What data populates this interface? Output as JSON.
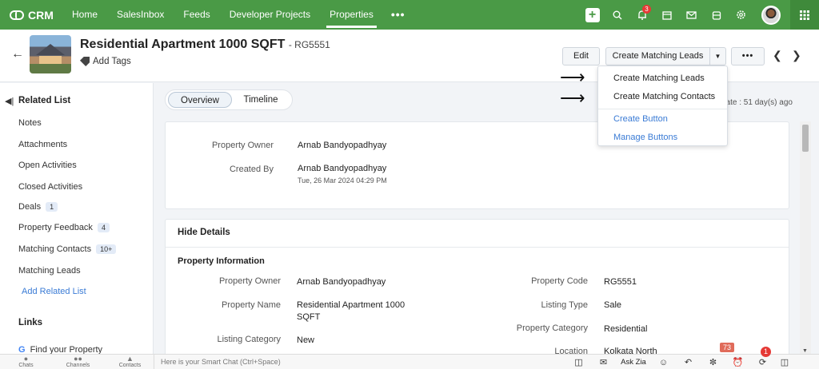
{
  "app": {
    "name": "CRM"
  },
  "nav": {
    "items": [
      "Home",
      "SalesInbox",
      "Feeds",
      "Developer Projects",
      "Properties"
    ],
    "active": "Properties",
    "more": "•••"
  },
  "topbar_icons": [
    "plus-icon",
    "search-icon",
    "bell-icon",
    "calendar-icon",
    "mail-icon",
    "store-icon",
    "gear-icon",
    "avatar",
    "apps-grid-icon"
  ],
  "notification_count": "3",
  "record": {
    "title": "Residential Apartment 1000 SQFT",
    "code": "- RG5551",
    "add_tags": "Add Tags"
  },
  "buttons": {
    "edit": "Edit",
    "create_matching_leads": "Create Matching Leads",
    "more": "•••"
  },
  "dropdown": {
    "items": [
      "Create Matching Leads",
      "Create Matching Contacts"
    ],
    "links": [
      "Create Button",
      "Manage Buttons"
    ]
  },
  "sidebar": {
    "title": "Related List",
    "items": [
      {
        "label": "Notes",
        "count": ""
      },
      {
        "label": "Attachments",
        "count": ""
      },
      {
        "label": "Open Activities",
        "count": ""
      },
      {
        "label": "Closed Activities",
        "count": ""
      },
      {
        "label": "Deals",
        "count": "1"
      },
      {
        "label": "Property Feedback",
        "count": "4"
      },
      {
        "label": "Matching Contacts",
        "count": "10+"
      },
      {
        "label": "Matching Leads",
        "count": ""
      }
    ],
    "add_related": "Add Related List",
    "links_title": "Links",
    "link_item": "Find your Property"
  },
  "tabs": {
    "overview": "Overview",
    "timeline": "Timeline"
  },
  "last_update": "date : 51 day(s) ago",
  "summary": {
    "owner_label": "Property Owner",
    "owner_value": "Arnab Bandyopadhyay",
    "created_label": "Created By",
    "created_value": "Arnab Bandyopadhyay",
    "created_time": "Tue, 26 Mar 2024 04:29 PM"
  },
  "details": {
    "hide_details": "Hide Details",
    "section": "Property Information",
    "left": [
      {
        "label": "Property Owner",
        "value": "Arnab Bandyopadhyay"
      },
      {
        "label": "Property Name",
        "value": "Residential Apartment 1000",
        "value2": "SQFT"
      },
      {
        "label": "Listing Category",
        "value": "New"
      }
    ],
    "right": [
      {
        "label": "Property Code",
        "value": "RG5551"
      },
      {
        "label": "Listing Type",
        "value": "Sale"
      },
      {
        "label": "Property Category",
        "value": "Residential"
      },
      {
        "label": "Location",
        "value": "Kolkata North"
      }
    ]
  },
  "bottombar": {
    "left": [
      "Chats",
      "Channels",
      "Contacts"
    ],
    "chat_placeholder": "Here is your Smart Chat (Ctrl+Space)",
    "ask_zia": "Ask Zia",
    "badge_count": "73",
    "alarm_count": "1"
  }
}
